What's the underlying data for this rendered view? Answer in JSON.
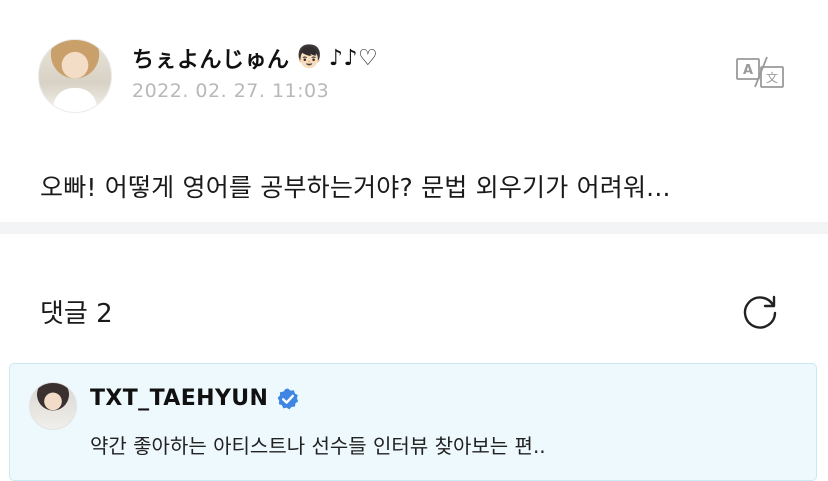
{
  "post": {
    "author_name": "ちぇよんじゅん",
    "author_emoji": "👦🏻",
    "author_suffix": "♪♪♡",
    "timestamp": "2022. 02. 27. 11:03",
    "body": "오빠! 어떻게 영어를 공부하는거야? 문법 외우기가 어려워..."
  },
  "comments": {
    "header": "댓글 2",
    "items": [
      {
        "author": "TXT_TAEHYUN",
        "verified": true,
        "text": "약간 좋아하는 아티스트나 선수들 인터뷰 찾아보는 편.."
      }
    ]
  },
  "icons": {
    "translate": "translate-icon",
    "refresh": "refresh-icon",
    "verified": "verified-badge-icon"
  },
  "colors": {
    "verified_blue": "#3f86e4",
    "card_background": "#eef9fd",
    "card_border": "#c9e9f4",
    "timestamp_gray": "#b8b8b8"
  }
}
